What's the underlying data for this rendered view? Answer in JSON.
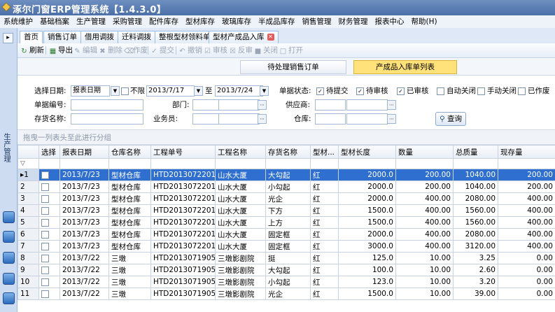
{
  "app": {
    "title": "涿尔门窗ERP管理系统【1.4.3.0】"
  },
  "menu": [
    "系统维护",
    "基础档案",
    "生产管理",
    "采购管理",
    "配件库存",
    "型材库存",
    "玻璃库存",
    "半成品库存",
    "销售管理",
    "财务管理",
    "报表中心",
    "帮助(H)"
  ],
  "sidebar": {
    "title": "生产管理"
  },
  "tabs": [
    {
      "label": "首页"
    },
    {
      "label": "销售订单"
    },
    {
      "label": "借用调拨"
    },
    {
      "label": "迁料调拨"
    },
    {
      "label": "整根型材领料单"
    },
    {
      "label": "型材产成品入库"
    }
  ],
  "toolbar": {
    "refresh": "刷新",
    "export": "导出",
    "edit": "编辑",
    "delete": "删除",
    "void": "作废",
    "submit": "提交",
    "revoke": "撤销",
    "audit": "审核",
    "unaudit": "反审",
    "close": "关闭",
    "open": "打开"
  },
  "subtabs": {
    "pending": "待处理销售订单",
    "list": "产成品入库单列表"
  },
  "filters": {
    "date_type_label": "选择日期:",
    "date_type": "报表日期",
    "unlimited": "不限",
    "date_from": "2013/7/17",
    "to": "至",
    "date_to": "2013/7/24",
    "status_label": "单据状态:",
    "statuses": [
      {
        "label": "待提交",
        "checked": true
      },
      {
        "label": "待审核",
        "checked": true
      },
      {
        "label": "已审核",
        "checked": true
      },
      {
        "label": "自动关闭",
        "checked": false
      },
      {
        "label": "手动关闭",
        "checked": false
      },
      {
        "label": "已作废",
        "checked": false
      }
    ],
    "doc_no_label": "单据编号:",
    "dept_label": "部门:",
    "supplier_label": "供应商:",
    "item_label": "存货名称:",
    "clerk_label": "业务员:",
    "warehouse_label": "仓库:",
    "query_button": "查询"
  },
  "group_hint": "拖曳一列表头至此进行分组",
  "table": {
    "columns": [
      "选择",
      "报表日期",
      "仓库名称",
      "工程单号",
      "工程名称",
      "存货名称",
      "型材...",
      "型材长度",
      "数量",
      "总质量",
      "现存量"
    ],
    "rows": [
      {
        "n": "1",
        "date": "2013/7/23",
        "wh": "型材仓库",
        "proj_no": "HTD2013072201",
        "proj": "山水大厦",
        "item": "大勾起",
        "color": "红",
        "len": "2000.0",
        "qty": "200.00",
        "weight": "1040.00",
        "stock": "200.00"
      },
      {
        "n": "2",
        "date": "2013/7/23",
        "wh": "型材仓库",
        "proj_no": "HTD2013072201",
        "proj": "山水大厦",
        "item": "小勾起",
        "color": "红",
        "len": "2000.0",
        "qty": "200.00",
        "weight": "1040.00",
        "stock": "200.00"
      },
      {
        "n": "3",
        "date": "2013/7/23",
        "wh": "型材仓库",
        "proj_no": "HTD2013072201",
        "proj": "山水大厦",
        "item": "光企",
        "color": "红",
        "len": "2000.0",
        "qty": "400.00",
        "weight": "2080.00",
        "stock": "400.00"
      },
      {
        "n": "4",
        "date": "2013/7/23",
        "wh": "型材仓库",
        "proj_no": "HTD2013072201",
        "proj": "山水大厦",
        "item": "下方",
        "color": "红",
        "len": "1500.0",
        "qty": "400.00",
        "weight": "1560.00",
        "stock": "400.00"
      },
      {
        "n": "5",
        "date": "2013/7/23",
        "wh": "型材仓库",
        "proj_no": "HTD2013072201",
        "proj": "山水大厦",
        "item": "上方",
        "color": "红",
        "len": "1500.0",
        "qty": "400.00",
        "weight": "1560.00",
        "stock": "400.00"
      },
      {
        "n": "6",
        "date": "2013/7/23",
        "wh": "型材仓库",
        "proj_no": "HTD2013072201",
        "proj": "山水大厦",
        "item": "固定框",
        "color": "红",
        "len": "2000.0",
        "qty": "400.00",
        "weight": "2080.00",
        "stock": "400.00"
      },
      {
        "n": "7",
        "date": "2013/7/23",
        "wh": "型材仓库",
        "proj_no": "HTD2013072201",
        "proj": "山水大厦",
        "item": "固定框",
        "color": "红",
        "len": "3000.0",
        "qty": "400.00",
        "weight": "3120.00",
        "stock": "400.00"
      },
      {
        "n": "8",
        "date": "2013/7/22",
        "wh": "三墩",
        "proj_no": "HTD2013071905",
        "proj": "三墩影剧院",
        "item": "挺",
        "color": "红",
        "len": "125.0",
        "qty": "10.00",
        "weight": "3.25",
        "stock": "0.00"
      },
      {
        "n": "9",
        "date": "2013/7/22",
        "wh": "三墩",
        "proj_no": "HTD2013071905",
        "proj": "三墩影剧院",
        "item": "大勾起",
        "color": "红",
        "len": "100.0",
        "qty": "10.00",
        "weight": "2.60",
        "stock": "0.00"
      },
      {
        "n": "10",
        "date": "2013/7/22",
        "wh": "三墩",
        "proj_no": "HTD2013071905",
        "proj": "三墩影剧院",
        "item": "小勾起",
        "color": "红",
        "len": "123.0",
        "qty": "10.00",
        "weight": "3.20",
        "stock": "0.00"
      },
      {
        "n": "11",
        "date": "2013/7/22",
        "wh": "三墩",
        "proj_no": "HTD2013071905",
        "proj": "三墩影剧院",
        "item": "光企",
        "color": "红",
        "len": "1500.0",
        "qty": "10.00",
        "weight": "39.00",
        "stock": "0.00"
      }
    ]
  }
}
